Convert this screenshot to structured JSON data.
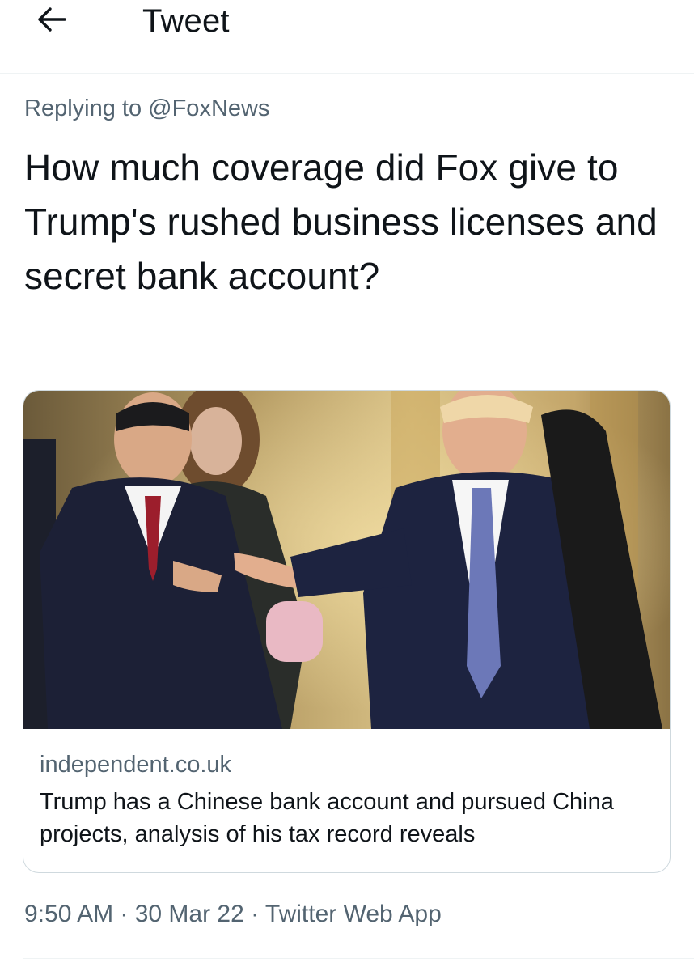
{
  "header": {
    "back_icon": "arrow-left-icon",
    "title": "Tweet"
  },
  "reply": {
    "prefix": "Replying to ",
    "handle": "@FoxNews"
  },
  "tweet": {
    "text": "How much coverage did Fox give to Trump's rushed business licenses and secret bank account?"
  },
  "card": {
    "image_description_icon": "photo",
    "domain": "independent.co.uk",
    "title": "Trump has a Chinese bank account and pursued China projects, analysis of his tax record reveals"
  },
  "meta": {
    "timestamp": "9:50 AM · 30 Mar 22 · Twitter Web App"
  },
  "colors": {
    "text_primary": "#0f1419",
    "text_secondary": "#536471",
    "border": "#cfd9de",
    "divider": "#eff3f4"
  }
}
